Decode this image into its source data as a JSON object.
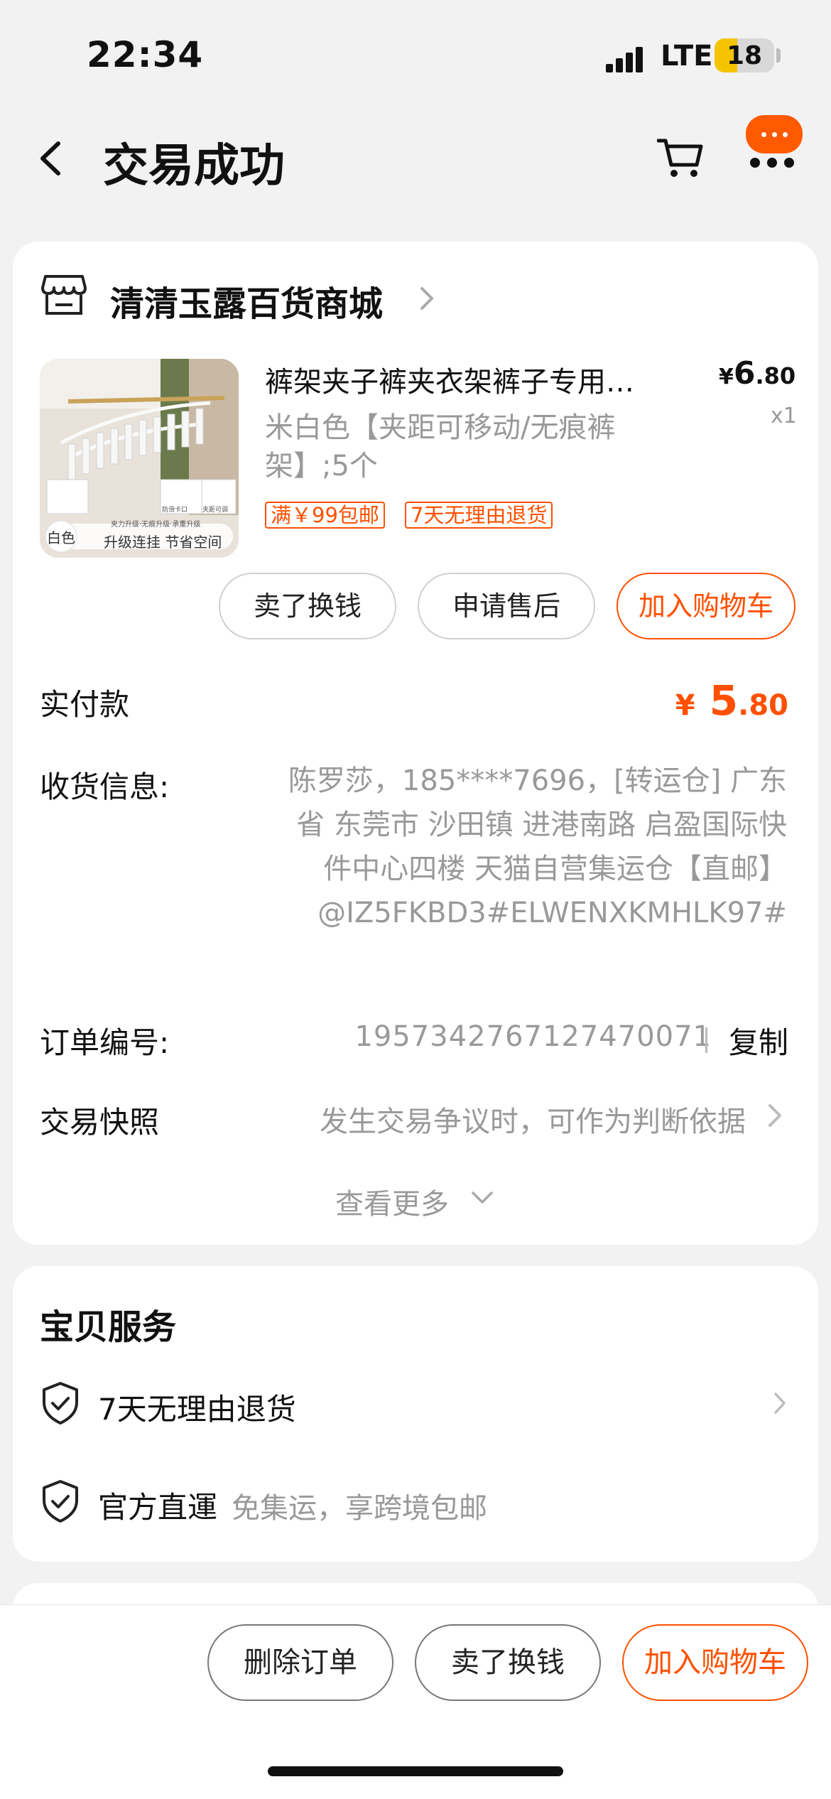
{
  "status_bar": {
    "time": "22:34",
    "network": "LTE",
    "battery": "18"
  },
  "header": {
    "title": "交易成功"
  },
  "order": {
    "shop_name": "清清玉露百货商城",
    "product": {
      "title": "裤架夹子裤夹衣架裤子专用…",
      "price_symbol": "¥",
      "price_int": "6",
      "price_dec": ".80",
      "qty": "x1",
      "sku": "米白色【夹距可移动/无痕裤架】;5个",
      "tags": [
        "满￥99包邮",
        "7天无理由退货"
      ],
      "thumb": {
        "badge": "白色",
        "caption": "升级连挂 节省空间",
        "headline": "夹力升级·无痕升级·承重升级",
        "small_labels": [
          "防滑卡口",
          "夹距可调"
        ]
      }
    },
    "actions": {
      "sell": "卖了换钱",
      "after_sale": "申请售后",
      "add_cart": "加入购物车"
    },
    "paid_label": "实付款",
    "paid_symbol": "¥",
    "paid_int": "5",
    "paid_dec": ".80",
    "address_label": "收货信息:",
    "address": "陈罗莎，185****7696，[转运仓] 广东省 东莞市 沙田镇 进港南路 启盈国际快件中心四楼 天猫自营集运仓【直邮】@IZ5FKBD3#ELWENXKMHLK97#",
    "order_no_label": "订单编号:",
    "order_no": "1957342767127470071",
    "copy": "复制",
    "snapshot_label": "交易快照",
    "snapshot_hint": "发生交易争议时，可作为判断依据",
    "see_more": "查看更多"
  },
  "services": {
    "title": "宝贝服务",
    "items": [
      {
        "text": "7天无理由退货",
        "sub": ""
      },
      {
        "text": "官方直運",
        "sub": "免集运，享跨境包邮"
      }
    ]
  },
  "bottom_bar": {
    "delete": "删除订单",
    "sell": "卖了换钱",
    "add_cart": "加入购物车"
  },
  "colors": {
    "accent": "#ff5000",
    "more_bubble": "#ff5a00"
  }
}
